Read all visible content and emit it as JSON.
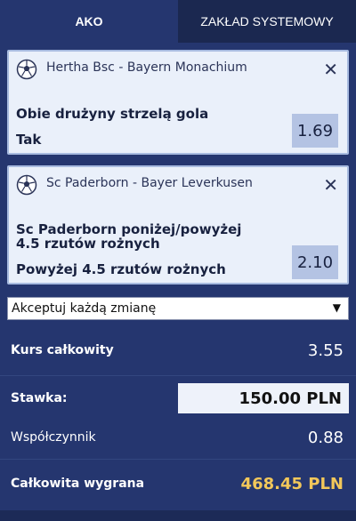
{
  "tabs": [
    {
      "label": "AKO",
      "active": true
    },
    {
      "label": "ZAKŁAD SYSTEMOWY",
      "active": false
    }
  ],
  "bets": [
    {
      "match": "Hertha Bsc - Bayern Monachium",
      "market": "Obie drużyny strzelą gola",
      "selection": "Tak",
      "odds": "1.69",
      "icon": "football-icon"
    },
    {
      "match": "Sc Paderborn - Bayer Leverkusen",
      "market_line1": "Sc Paderborn poniżej/powyżej",
      "market_line2": "4.5 rzutów rożnych",
      "selection": "Powyżej 4.5 rzutów rożnych",
      "odds": "2.10",
      "icon": "football-icon"
    }
  ],
  "odds_change_select": {
    "value": "Akceptuj każdą zmianę"
  },
  "summary": {
    "total_odds_label": "Kurs całkowity",
    "total_odds_value": "3.55",
    "stake_label": "Stawka:",
    "stake_value": "150.00 PLN",
    "coefficient_label": "Współczynnik",
    "coefficient_value": "0.88",
    "total_win_label": "Całkowita wygrana",
    "total_win_value": "468.45 PLN"
  },
  "colors": {
    "background": "#25366f",
    "card": "#eaf0fa",
    "odds_box": "#b4c3e3",
    "win_highlight": "#f2c75a"
  }
}
